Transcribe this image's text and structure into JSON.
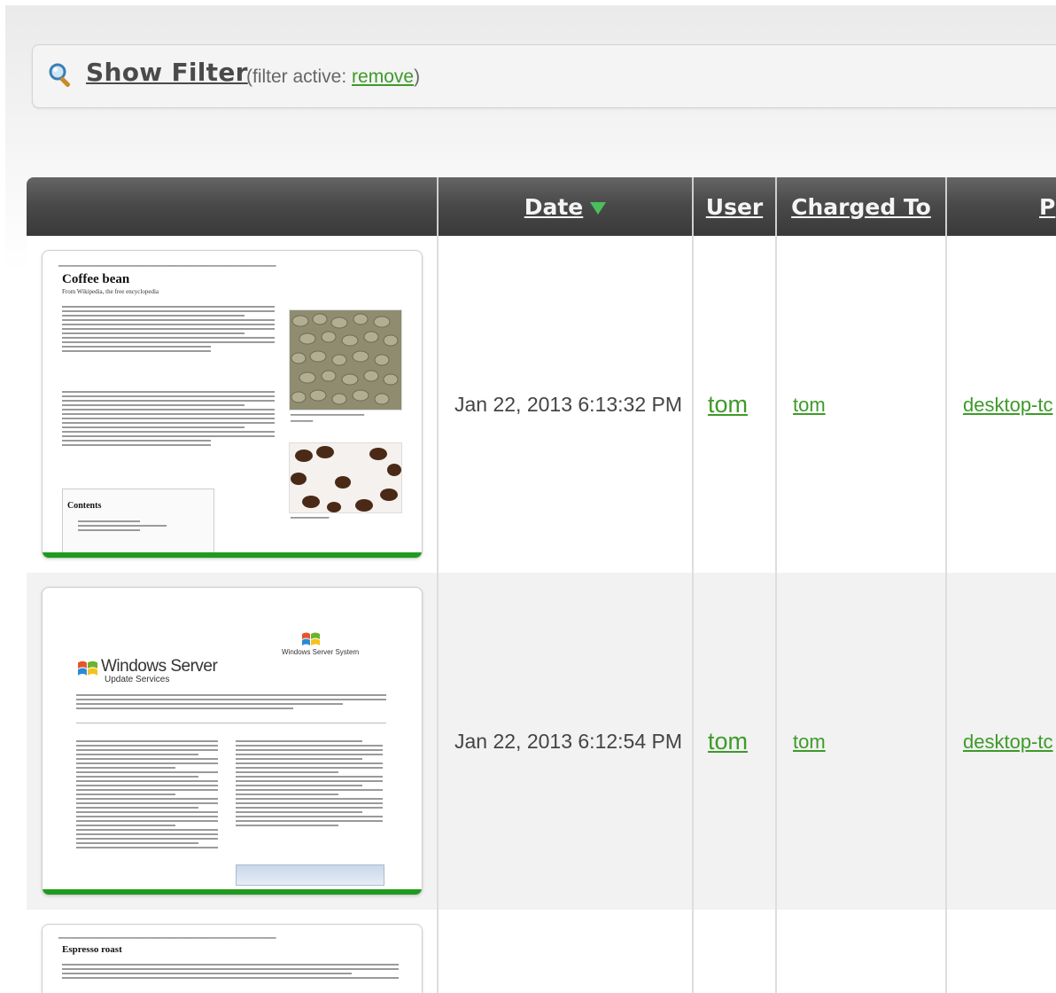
{
  "filter": {
    "icon": "search-icon",
    "show_label": "Show Filter",
    "status_prefix": "(filter active: ",
    "remove_label": "remove",
    "status_suffix": ")"
  },
  "table": {
    "columns": {
      "preview": "",
      "date": "Date",
      "user": "User",
      "charged_to": "Charged To",
      "printer": "P"
    },
    "sort_indicator": "sort-descending-icon",
    "rows": [
      {
        "date": "Jan 22, 2013 6:13:32 PM",
        "user": "tom",
        "charged_to": "tom",
        "printer": "desktop-tc",
        "thumb": {
          "title": "Coffee bean",
          "subtitle": "From Wikipedia, the free encyclopedia",
          "contents_title": "Contents"
        }
      },
      {
        "date": "Jan 22, 2013 6:12:54 PM",
        "user": "tom",
        "charged_to": "tom",
        "printer": "desktop-tc",
        "thumb": {
          "brand_small": "Windows Server System",
          "brand_title": "Windows Server",
          "brand_sub": "Update Services"
        }
      },
      {
        "thumb": {
          "title": "Espresso roast"
        }
      }
    ]
  },
  "colors": {
    "link_green": "#3e9a2a",
    "header_dark": "#3f3f3f",
    "status_bar_green": "#1f9a1f",
    "sort_arrow_green": "#4bbf5a"
  }
}
